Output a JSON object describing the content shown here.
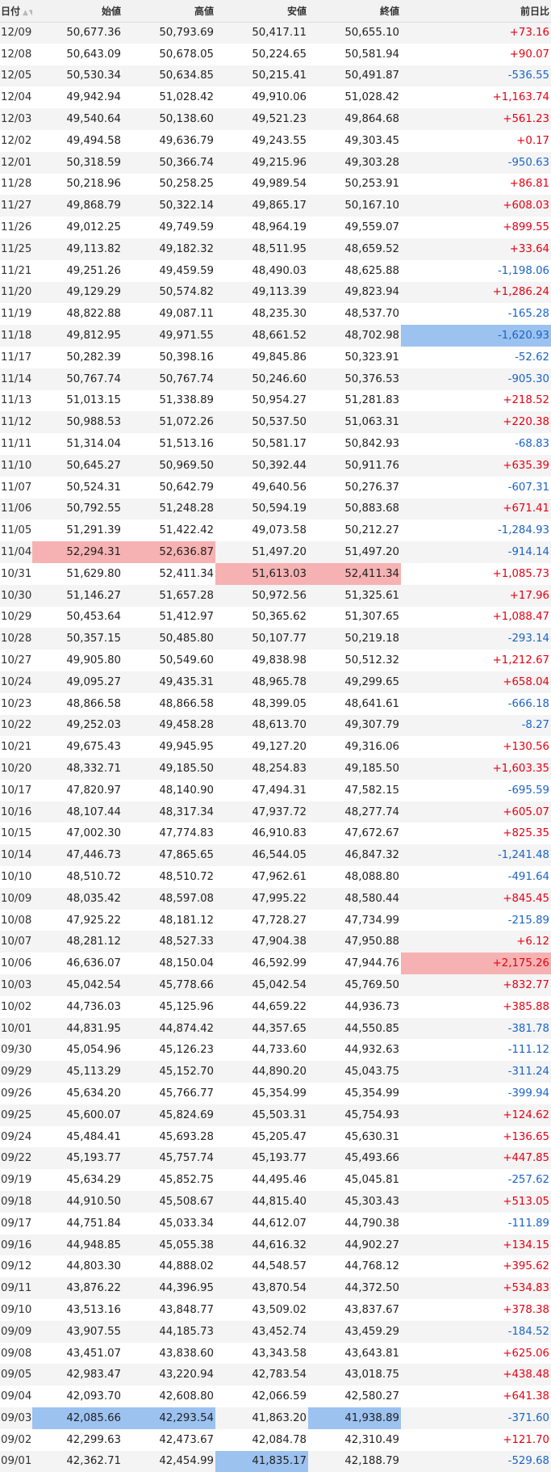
{
  "headers": {
    "date": "日付",
    "open": "始値",
    "high": "高値",
    "low": "安値",
    "close": "終値",
    "change": "前日比"
  },
  "sort_icons": "▲▼",
  "rows": [
    [
      "12/09",
      "50,677.36",
      "50,793.69",
      "50,417.11",
      "50,655.10",
      "+73.16"
    ],
    [
      "12/08",
      "50,643.09",
      "50,678.05",
      "50,224.65",
      "50,581.94",
      "+90.07"
    ],
    [
      "12/05",
      "50,530.34",
      "50,634.85",
      "50,215.41",
      "50,491.87",
      "-536.55"
    ],
    [
      "12/04",
      "49,942.94",
      "51,028.42",
      "49,910.06",
      "51,028.42",
      "+1,163.74"
    ],
    [
      "12/03",
      "49,540.64",
      "50,138.60",
      "49,521.23",
      "49,864.68",
      "+561.23"
    ],
    [
      "12/02",
      "49,494.58",
      "49,636.79",
      "49,243.55",
      "49,303.45",
      "+0.17"
    ],
    [
      "12/01",
      "50,318.59",
      "50,366.74",
      "49,215.96",
      "49,303.28",
      "-950.63"
    ],
    [
      "11/28",
      "50,218.96",
      "50,258.25",
      "49,989.54",
      "50,253.91",
      "+86.81"
    ],
    [
      "11/27",
      "49,868.79",
      "50,322.14",
      "49,865.17",
      "50,167.10",
      "+608.03"
    ],
    [
      "11/26",
      "49,012.25",
      "49,749.59",
      "48,964.19",
      "49,559.07",
      "+899.55"
    ],
    [
      "11/25",
      "49,113.82",
      "49,182.32",
      "48,511.95",
      "48,659.52",
      "+33.64"
    ],
    [
      "11/21",
      "49,251.26",
      "49,459.59",
      "48,490.03",
      "48,625.88",
      "-1,198.06"
    ],
    [
      "11/20",
      "49,129.29",
      "50,574.82",
      "49,113.39",
      "49,823.94",
      "+1,286.24"
    ],
    [
      "11/19",
      "48,822.88",
      "49,087.11",
      "48,235.30",
      "48,537.70",
      "-165.28"
    ],
    [
      "11/18",
      "49,812.95",
      "49,971.55",
      "48,661.52",
      "48,702.98",
      "-1,620.93"
    ],
    [
      "11/17",
      "50,282.39",
      "50,398.16",
      "49,845.86",
      "50,323.91",
      "-52.62"
    ],
    [
      "11/14",
      "50,767.74",
      "50,767.74",
      "50,246.60",
      "50,376.53",
      "-905.30"
    ],
    [
      "11/13",
      "51,013.15",
      "51,338.89",
      "50,954.27",
      "51,281.83",
      "+218.52"
    ],
    [
      "11/12",
      "50,988.53",
      "51,072.26",
      "50,537.50",
      "51,063.31",
      "+220.38"
    ],
    [
      "11/11",
      "51,314.04",
      "51,513.16",
      "50,581.17",
      "50,842.93",
      "-68.83"
    ],
    [
      "11/10",
      "50,645.27",
      "50,969.50",
      "50,392.44",
      "50,911.76",
      "+635.39"
    ],
    [
      "11/07",
      "50,524.31",
      "50,642.79",
      "49,640.56",
      "50,276.37",
      "-607.31"
    ],
    [
      "11/06",
      "50,792.55",
      "51,248.28",
      "50,594.19",
      "50,883.68",
      "+671.41"
    ],
    [
      "11/05",
      "51,291.39",
      "51,422.42",
      "49,073.58",
      "50,212.27",
      "-1,284.93"
    ],
    [
      "11/04",
      "52,294.31",
      "52,636.87",
      "51,497.20",
      "51,497.20",
      "-914.14"
    ],
    [
      "10/31",
      "51,629.80",
      "52,411.34",
      "51,613.03",
      "52,411.34",
      "+1,085.73"
    ],
    [
      "10/30",
      "51,146.27",
      "51,657.28",
      "50,972.56",
      "51,325.61",
      "+17.96"
    ],
    [
      "10/29",
      "50,453.64",
      "51,412.97",
      "50,365.62",
      "51,307.65",
      "+1,088.47"
    ],
    [
      "10/28",
      "50,357.15",
      "50,485.80",
      "50,107.77",
      "50,219.18",
      "-293.14"
    ],
    [
      "10/27",
      "49,905.80",
      "50,549.60",
      "49,838.98",
      "50,512.32",
      "+1,212.67"
    ],
    [
      "10/24",
      "49,095.27",
      "49,435.31",
      "48,965.78",
      "49,299.65",
      "+658.04"
    ],
    [
      "10/23",
      "48,866.58",
      "48,866.58",
      "48,399.05",
      "48,641.61",
      "-666.18"
    ],
    [
      "10/22",
      "49,252.03",
      "49,458.28",
      "48,613.70",
      "49,307.79",
      "-8.27"
    ],
    [
      "10/21",
      "49,675.43",
      "49,945.95",
      "49,127.20",
      "49,316.06",
      "+130.56"
    ],
    [
      "10/20",
      "48,332.71",
      "49,185.50",
      "48,254.83",
      "49,185.50",
      "+1,603.35"
    ],
    [
      "10/17",
      "47,820.97",
      "48,140.90",
      "47,494.31",
      "47,582.15",
      "-695.59"
    ],
    [
      "10/16",
      "48,107.44",
      "48,317.34",
      "47,937.72",
      "48,277.74",
      "+605.07"
    ],
    [
      "10/15",
      "47,002.30",
      "47,774.83",
      "46,910.83",
      "47,672.67",
      "+825.35"
    ],
    [
      "10/14",
      "47,446.73",
      "47,865.65",
      "46,544.05",
      "46,847.32",
      "-1,241.48"
    ],
    [
      "10/10",
      "48,510.72",
      "48,510.72",
      "47,962.61",
      "48,088.80",
      "-491.64"
    ],
    [
      "10/09",
      "48,035.42",
      "48,597.08",
      "47,995.22",
      "48,580.44",
      "+845.45"
    ],
    [
      "10/08",
      "47,925.22",
      "48,181.12",
      "47,728.27",
      "47,734.99",
      "-215.89"
    ],
    [
      "10/07",
      "48,281.12",
      "48,527.33",
      "47,904.38",
      "47,950.88",
      "+6.12"
    ],
    [
      "10/06",
      "46,636.07",
      "48,150.04",
      "46,592.99",
      "47,944.76",
      "+2,175.26"
    ],
    [
      "10/03",
      "45,042.54",
      "45,778.66",
      "45,042.54",
      "45,769.50",
      "+832.77"
    ],
    [
      "10/02",
      "44,736.03",
      "45,125.96",
      "44,659.22",
      "44,936.73",
      "+385.88"
    ],
    [
      "10/01",
      "44,831.95",
      "44,874.42",
      "44,357.65",
      "44,550.85",
      "-381.78"
    ],
    [
      "09/30",
      "45,054.96",
      "45,126.23",
      "44,733.60",
      "44,932.63",
      "-111.12"
    ],
    [
      "09/29",
      "45,113.29",
      "45,152.70",
      "44,890.20",
      "45,043.75",
      "-311.24"
    ],
    [
      "09/26",
      "45,634.20",
      "45,766.77",
      "45,354.99",
      "45,354.99",
      "-399.94"
    ],
    [
      "09/25",
      "45,600.07",
      "45,824.69",
      "45,503.31",
      "45,754.93",
      "+124.62"
    ],
    [
      "09/24",
      "45,484.41",
      "45,693.28",
      "45,205.47",
      "45,630.31",
      "+136.65"
    ],
    [
      "09/22",
      "45,193.77",
      "45,757.74",
      "45,193.77",
      "45,493.66",
      "+447.85"
    ],
    [
      "09/19",
      "45,634.29",
      "45,852.75",
      "44,495.46",
      "45,045.81",
      "-257.62"
    ],
    [
      "09/18",
      "44,910.50",
      "45,508.67",
      "44,815.40",
      "45,303.43",
      "+513.05"
    ],
    [
      "09/17",
      "44,751.84",
      "45,033.34",
      "44,612.07",
      "44,790.38",
      "-111.89"
    ],
    [
      "09/16",
      "44,948.85",
      "45,055.38",
      "44,616.32",
      "44,902.27",
      "+134.15"
    ],
    [
      "09/12",
      "44,803.30",
      "44,888.02",
      "44,548.57",
      "44,768.12",
      "+395.62"
    ],
    [
      "09/11",
      "43,876.22",
      "44,396.95",
      "43,870.54",
      "44,372.50",
      "+534.83"
    ],
    [
      "09/10",
      "43,513.16",
      "43,848.77",
      "43,509.02",
      "43,837.67",
      "+378.38"
    ],
    [
      "09/09",
      "43,907.55",
      "44,185.73",
      "43,452.74",
      "43,459.29",
      "-184.52"
    ],
    [
      "09/08",
      "43,451.07",
      "43,838.60",
      "43,343.58",
      "43,643.81",
      "+625.06"
    ],
    [
      "09/05",
      "42,983.47",
      "43,220.94",
      "42,783.54",
      "43,018.75",
      "+438.48"
    ],
    [
      "09/04",
      "42,093.70",
      "42,608.80",
      "42,066.59",
      "42,580.27",
      "+641.38"
    ],
    [
      "09/03",
      "42,085.66",
      "42,293.54",
      "41,863.20",
      "41,938.89",
      "-371.60"
    ],
    [
      "09/02",
      "42,299.63",
      "42,473.67",
      "42,084.78",
      "42,310.49",
      "+121.70"
    ],
    [
      "09/01",
      "42,362.71",
      "42,454.99",
      "41,835.17",
      "42,188.79",
      "-529.68"
    ]
  ],
  "highlights": [
    {
      "row": 14,
      "col": 5,
      "color": "blue"
    },
    {
      "row": 24,
      "col": 1,
      "color": "red"
    },
    {
      "row": 24,
      "col": 2,
      "color": "red"
    },
    {
      "row": 25,
      "col": 3,
      "color": "red"
    },
    {
      "row": 25,
      "col": 4,
      "color": "red"
    },
    {
      "row": 43,
      "col": 5,
      "color": "red"
    },
    {
      "row": 64,
      "col": 1,
      "color": "blue"
    },
    {
      "row": 64,
      "col": 2,
      "color": "blue"
    },
    {
      "row": 64,
      "col": 4,
      "color": "blue"
    },
    {
      "row": 66,
      "col": 3,
      "color": "blue"
    }
  ],
  "colors": {
    "up": "#e60012",
    "down": "#1a64c8",
    "highlight_red": "#f6b2b2",
    "highlight_blue": "#9cc2f0"
  }
}
